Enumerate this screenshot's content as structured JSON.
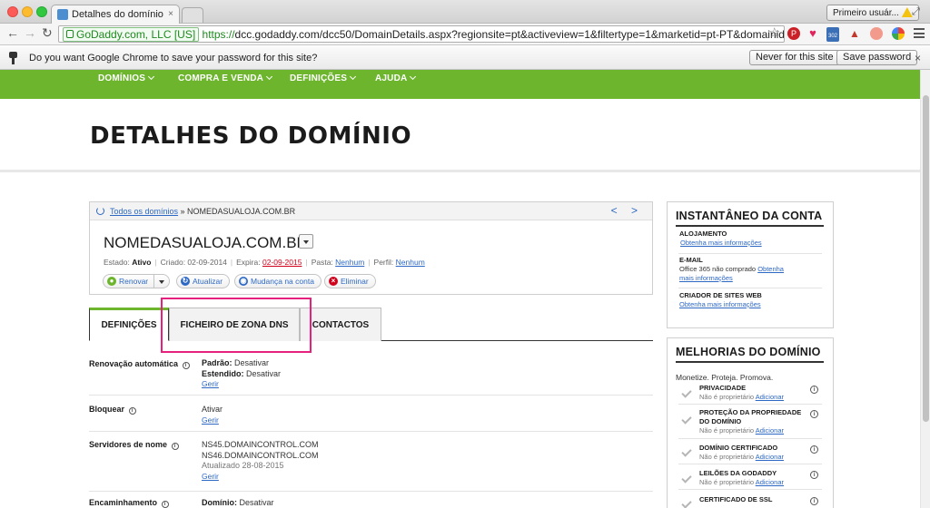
{
  "browser": {
    "tab_title": "Detalhes do domínio",
    "tab_close": "×",
    "user_button": "Primeiro usuár...",
    "ev_label": "GoDaddy.com, LLC [US]",
    "url_scheme": "https://",
    "url_rest": "dcc.godaddy.com/dcc50/DomainDetails.aspx?regionsite=pt&activeview=1&filtertype=1&marketid=pt-PT&domainid=17...",
    "ext_badge": "302"
  },
  "infobar": {
    "message": "Do you want Google Chrome to save your password for this site?",
    "never_button": "Never for this site",
    "save_button": "Save password",
    "close": "×"
  },
  "nav": {
    "items": [
      "DOMÍNIOS",
      "COMPRA E VENDA",
      "DEFINIÇÕES",
      "AJUDA"
    ]
  },
  "page": {
    "title": "DETALHES DO DOMÍNIO"
  },
  "card": {
    "breadcrumb_link": "Todos os domínios",
    "breadcrumb_rest": " » NOMEDASUALOJA.COM.BR",
    "nav_arrows": "< >",
    "domain": "NOMEDASUALOJA.COM.BR",
    "meta": {
      "estado_label": "Estado:",
      "estado_value": "Ativo",
      "criado": "Criado: 02-09-2014",
      "expira_label": "Expira:",
      "expira_value": "02-09-2015",
      "pasta_label": "Pasta:",
      "pasta_value": "Nenhum",
      "perfil_label": "Perfil:",
      "perfil_value": "Nenhum"
    },
    "actions": {
      "renovar": "Renovar",
      "atualizar": "Atualizar",
      "mudanca": "Mudança na conta",
      "eliminar": "Eliminar"
    }
  },
  "tabs": {
    "definicoes": "DEFINIÇÕES",
    "dns": "FICHEIRO DE ZONA DNS",
    "contactos": "CONTACTOS"
  },
  "settings": {
    "renovacao": {
      "label": "Renovação automática",
      "padrao_label": "Padrão:",
      "padrao_value": "Desativar",
      "estendido_label": "Estendido:",
      "estendido_value": "Desativar",
      "manage": "Gerir"
    },
    "bloquear": {
      "label": "Bloquear",
      "value": "Ativar",
      "manage": "Gerir"
    },
    "servidores": {
      "label": "Servidores de nome",
      "ns1": "NS45.DOMAINCONTROL.COM",
      "ns2": "NS46.DOMAINCONTROL.COM",
      "updated": "Atualizado 28-08-2015",
      "manage": "Gerir"
    },
    "encaminhamento": {
      "label": "Encaminhamento",
      "dominio_label": "Domínio:",
      "dominio_value": "Desativar"
    }
  },
  "snapshot": {
    "title": "INSTANTÂNEO DA CONTA",
    "alojamento": {
      "head": "ALOJAMENTO",
      "link": "Obtenha mais informações"
    },
    "email": {
      "head": "E-MAIL",
      "text": "Office 365 não comprado",
      "link1": "Obtenha",
      "link2": "mais informações"
    },
    "sites": {
      "head": "CRIADOR DE SITES WEB",
      "link": "Obtenha mais informações"
    }
  },
  "improvements": {
    "title": "MELHORIAS DO DOMÍNIO",
    "subtitle": "Monetize. Proteja. Promova.",
    "not_owner": "Não é proprietário",
    "add": "Adicionar",
    "items": [
      "PRIVACIDADE",
      "PROTEÇÃO DA PROPRIEDADE DO DOMÍNIO",
      "DOMÍNIO CERTIFICADO",
      "LEILÕES DA GODADDY",
      "CERTIFICADO DE SSL"
    ]
  },
  "colors": {
    "brand_green": "#6cb52d",
    "link_blue": "#2d68c4",
    "highlight_pink": "#e5207d",
    "expiry_red": "#d0021b"
  }
}
